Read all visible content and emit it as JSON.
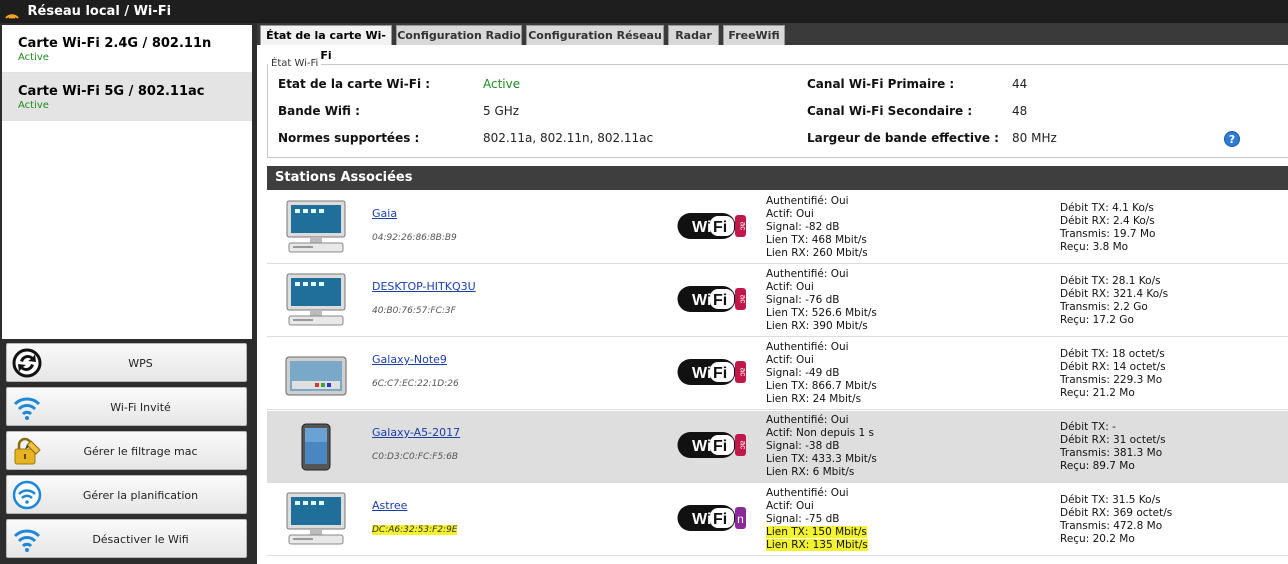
{
  "title": "Réseau local / Wi-Fi",
  "cards": [
    {
      "name": "Carte Wi-Fi 2.4G / 802.11n",
      "status": "Active"
    },
    {
      "name": "Carte Wi-Fi 5G / 802.11ac",
      "status": "Active"
    }
  ],
  "actions": {
    "wps": "WPS",
    "guest": "Wi-Fi Invité",
    "mac": "Gérer le filtrage mac",
    "planning": "Gérer la planification",
    "disable": "Désactiver le Wifi"
  },
  "tabs": [
    "État de la carte Wi-Fi",
    "Configuration Radio",
    "Configuration Réseau",
    "Radar",
    "FreeWifi"
  ],
  "etat": {
    "legend": "État Wi-Fi",
    "etat_label": "Etat de la carte Wi-Fi :",
    "etat_value": "Active",
    "bande_label": "Bande Wifi :",
    "bande_value": "5 GHz",
    "normes_label": "Normes supportées :",
    "normes_value": "802.11a, 802.11n, 802.11ac",
    "canal1_label": "Canal Wi-Fi Primaire :",
    "canal1_value": "44",
    "canal2_label": "Canal Wi-Fi Secondaire :",
    "canal2_value": "48",
    "largeur_label": "Largeur de bande effective :",
    "largeur_value": "80 MHz",
    "help": "?"
  },
  "stations_header": "Stations Associées",
  "stations": [
    {
      "name": "Gaia",
      "mac": "04:92:26:86:8B:B9",
      "icon": "desktop-computer-icon",
      "badge": "ac",
      "auth": "Authentifié: Oui",
      "actif": "Actif: Oui",
      "signal": "Signal: -82 dB",
      "lientx": "Lien TX: 468 Mbit/s",
      "lienrx": "Lien RX: 260 Mbit/s",
      "debittx": "Débit TX: 4.1 Ko/s",
      "debitrx": "Débit RX: 2.4 Ko/s",
      "transmis": "Transmis: 19.7 Mo",
      "recu": "Reçu: 3.8 Mo"
    },
    {
      "name": "DESKTOP-HITKQ3U",
      "mac": "40:B0:76:57:FC:3F",
      "icon": "desktop-computer-icon",
      "badge": "ac",
      "auth": "Authentifié: Oui",
      "actif": "Actif: Oui",
      "signal": "Signal: -76 dB",
      "lientx": "Lien TX: 526.6 Mbit/s",
      "lienrx": "Lien RX: 390 Mbit/s",
      "debittx": "Débit TX: 28.1 Ko/s",
      "debitrx": "Débit RX: 321.4 Ko/s",
      "transmis": "Transmis: 2.2 Go",
      "recu": "Reçu: 17.2 Go"
    },
    {
      "name": "Galaxy-Note9",
      "mac": "6C:C7:EC:22:1D:26",
      "icon": "tablet-icon",
      "badge": "ac",
      "auth": "Authentifié: Oui",
      "actif": "Actif: Oui",
      "signal": "Signal: -49 dB",
      "lientx": "Lien TX: 866.7 Mbit/s",
      "lienrx": "Lien RX: 24 Mbit/s",
      "debittx": "Débit TX: 18 octet/s",
      "debitrx": "Débit RX: 14 octet/s",
      "transmis": "Transmis: 229.3 Mo",
      "recu": "Reçu: 21.2 Mo"
    },
    {
      "name": "Galaxy-A5-2017",
      "mac": "C0:D3:C0:FC:F5:6B",
      "icon": "smartphone-icon",
      "badge": "ac",
      "auth": "Authentifié: Oui",
      "actif": "Actif: Non depuis 1 s",
      "signal": "Signal: -38 dB",
      "lientx": "Lien TX: 433.3 Mbit/s",
      "lienrx": "Lien RX: 6 Mbit/s",
      "debittx": "Débit TX: -",
      "debitrx": "Débit RX: 31 octet/s",
      "transmis": "Transmis: 381.3 Mo",
      "recu": "Reçu: 89.7 Mo"
    },
    {
      "name": "Astree",
      "mac": "DC:A6:32:53:F2:9E",
      "icon": "desktop-computer-icon",
      "badge": "n",
      "auth": "Authentifié: Oui",
      "actif": "Actif: Oui",
      "signal": "Signal: -75 dB",
      "lientx": "Lien TX: 150 Mbit/s",
      "lienrx": "Lien RX: 135 Mbit/s",
      "debittx": "Débit TX: 31.5 Ko/s",
      "debitrx": "Débit RX: 369 octet/s",
      "transmis": "Transmis: 472.8 Mo",
      "recu": "Reçu: 20.2 Mo"
    }
  ],
  "wifi_logo_text": {
    "wi": "Wi",
    "fi": "Fi"
  },
  "colors": {
    "active_green": "#1f8a1f",
    "badge_ac": "#c0184a",
    "badge_n": "#8a2a96",
    "highlight": "#f2f230",
    "link": "#1a3ea8"
  }
}
